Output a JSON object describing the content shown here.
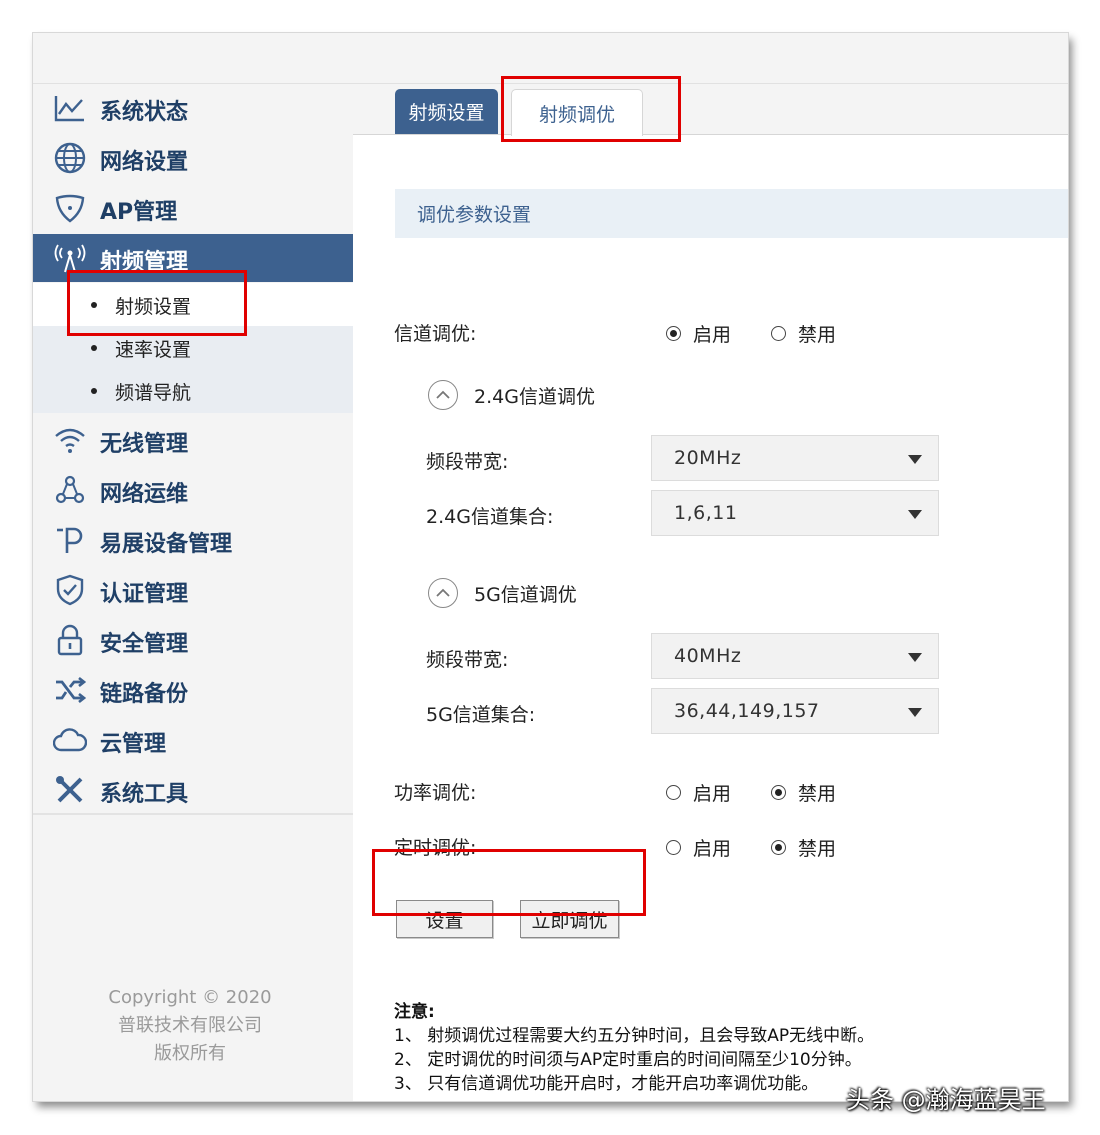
{
  "sidebar": {
    "items": [
      {
        "label": "系统状态",
        "icon": "line-chart-icon"
      },
      {
        "label": "网络设置",
        "icon": "globe-icon"
      },
      {
        "label": "AP管理",
        "icon": "ap-device-icon"
      },
      {
        "label": "射频管理",
        "icon": "radio-antenna-icon"
      },
      {
        "label": "无线管理",
        "icon": "wifi-icon"
      },
      {
        "label": "网络运维",
        "icon": "network-nodes-icon"
      },
      {
        "label": "易展设备管理",
        "icon": "easy-expand-icon"
      },
      {
        "label": "认证管理",
        "icon": "shield-check-icon"
      },
      {
        "label": "安全管理",
        "icon": "lock-icon"
      },
      {
        "label": "链路备份",
        "icon": "shuffle-icon"
      },
      {
        "label": "云管理",
        "icon": "cloud-icon"
      },
      {
        "label": "系统工具",
        "icon": "tools-icon"
      }
    ],
    "submenu": [
      {
        "label": "射频设置"
      },
      {
        "label": "速率设置"
      },
      {
        "label": "频谱导航"
      }
    ],
    "copyright": [
      "Copyright © 2020",
      "普联技术有限公司",
      "版权所有"
    ]
  },
  "tabs": [
    {
      "label": "射频设置"
    },
    {
      "label": "射频调优"
    }
  ],
  "section": {
    "title": "调优参数设置"
  },
  "form": {
    "channel_tuning": {
      "label": "信道调优:",
      "enable": "启用",
      "disable": "禁用",
      "selected": "enable"
    },
    "g24": {
      "title": "2.4G信道调优",
      "bandwidth_label": "频段带宽:",
      "bandwidth_value": "20MHz",
      "channels_label": "2.4G信道集合:",
      "channels_value": "1,6,11"
    },
    "g5": {
      "title": "5G信道调优",
      "bandwidth_label": "频段带宽:",
      "bandwidth_value": "40MHz",
      "channels_label": "5G信道集合:",
      "channels_value": "36,44,149,157"
    },
    "power_tuning": {
      "label": "功率调优:",
      "enable": "启用",
      "disable": "禁用",
      "selected": "disable"
    },
    "timed_tuning": {
      "label": "定时调优:",
      "enable": "启用",
      "disable": "禁用",
      "selected": "disable"
    }
  },
  "buttons": {
    "set": "设置",
    "tune_now": "立即调优"
  },
  "notes": {
    "title": "注意:",
    "lines": [
      "1、 射频调优过程需要大约五分钟时间，且会导致AP无线中断。",
      "2、 定时调优的时间须与AP定时重启的时间间隔至少10分钟。",
      "3、 只有信道调优功能开启时，才能开启功率调优功能。"
    ]
  },
  "watermark": "头条 @瀚海蓝昊王",
  "colors": {
    "accent": "#3d618f",
    "highlight_box": "#e00000",
    "nav_text": "#1f3f66"
  }
}
